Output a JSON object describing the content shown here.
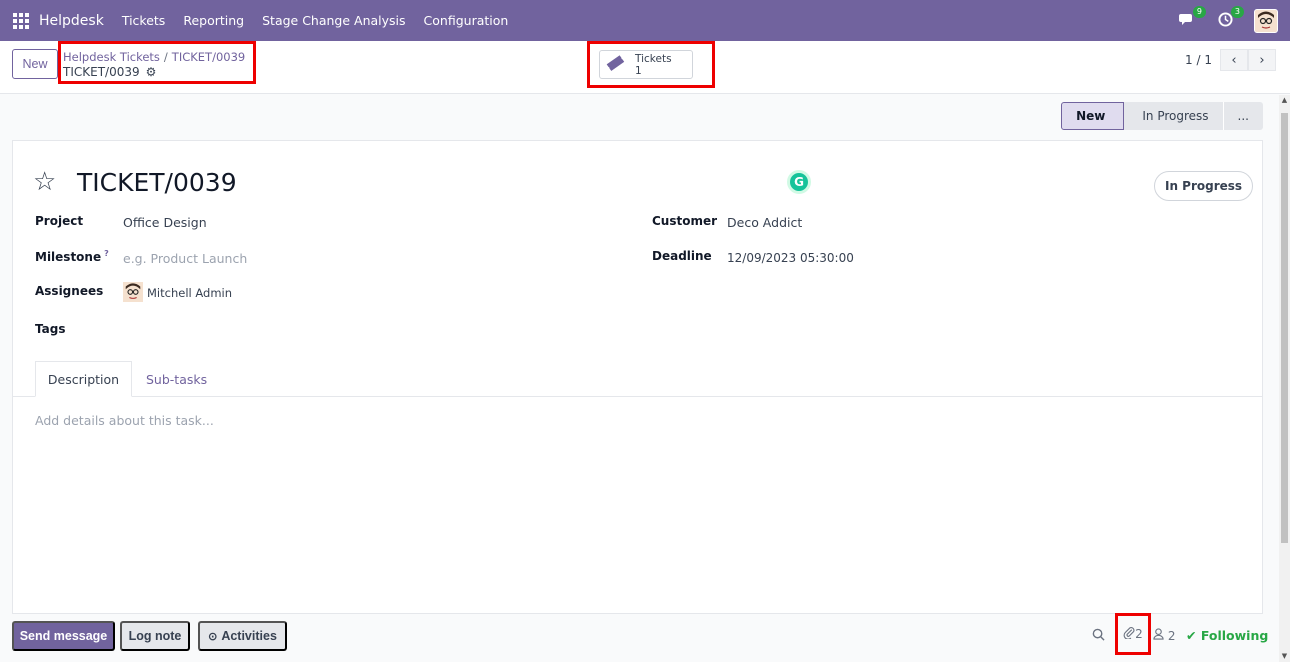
{
  "navbar": {
    "brand": "Helpdesk",
    "menu": [
      "Tickets",
      "Reporting",
      "Stage Change Analysis",
      "Configuration"
    ],
    "messages_badge": "9",
    "activities_badge": "3"
  },
  "control_panel": {
    "new_label": "New",
    "breadcrumb_parent": "Helpdesk Tickets",
    "breadcrumb_sep": "/",
    "breadcrumb_current_link": "TICKET/0039",
    "breadcrumb_current": "TICKET/0039",
    "stat_label": "Tickets",
    "stat_value": "1",
    "pager_value": "1 / 1"
  },
  "statusbar": {
    "stages": [
      "New",
      "In Progress",
      "..."
    ]
  },
  "form": {
    "title": "TICKET/0039",
    "state": "In Progress",
    "fields": {
      "project_label": "Project",
      "project_value": "Office Design",
      "milestone_label": "Milestone",
      "milestone_help": "?",
      "milestone_placeholder": "e.g. Product Launch",
      "assignees_label": "Assignees",
      "assignees_value": "Mitchell Admin",
      "tags_label": "Tags",
      "customer_label": "Customer",
      "customer_value": "Deco Addict",
      "deadline_label": "Deadline",
      "deadline_value": "12/09/2023 05:30:00"
    },
    "tabs": [
      "Description",
      "Sub-tasks"
    ],
    "description_placeholder": "Add details about this task..."
  },
  "chatter": {
    "send_message": "Send message",
    "log_note": "Log note",
    "activities": "Activities",
    "attachments_count": "2",
    "followers_count": "2",
    "following_label": "Following"
  },
  "colors": {
    "brand": "#71639e",
    "highlight": "#ee0000",
    "following": "#28a745"
  }
}
